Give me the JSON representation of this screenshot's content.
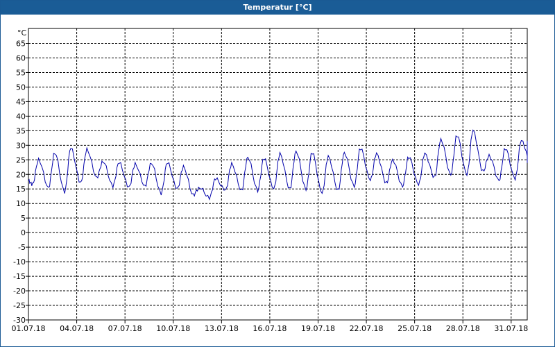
{
  "window": {
    "title": "Temperatur [°C]"
  },
  "chart_data": {
    "type": "line",
    "title": "Temperatur [°C]",
    "y_unit_label": "°C",
    "xlabel": "",
    "ylabel": "",
    "ylim": [
      -30,
      65
    ],
    "y_ticks": [
      65,
      60,
      55,
      50,
      45,
      40,
      35,
      30,
      25,
      20,
      15,
      10,
      5,
      0,
      -5,
      -10,
      -15,
      -20,
      -25,
      -30
    ],
    "x_range_days": [
      0,
      31
    ],
    "x_ticks": [
      {
        "day": 0,
        "label": "01.07.18"
      },
      {
        "day": 3,
        "label": "04.07.18"
      },
      {
        "day": 6,
        "label": "07.07.18"
      },
      {
        "day": 9,
        "label": "10.07.18"
      },
      {
        "day": 12,
        "label": "13.07.18"
      },
      {
        "day": 15,
        "label": "16.07.18"
      },
      {
        "day": 18,
        "label": "19.07.18"
      },
      {
        "day": 21,
        "label": "22.07.18"
      },
      {
        "day": 24,
        "label": "25.07.18"
      },
      {
        "day": 27,
        "label": "28.07.18"
      },
      {
        "day": 30,
        "label": "31.07.18"
      }
    ],
    "grid": true,
    "series": [
      {
        "color": "#0000aa",
        "daily": [
          {
            "min": 16.5,
            "max": 25.0
          },
          {
            "min": 15.5,
            "max": 27.5
          },
          {
            "min": 14.0,
            "max": 29.0
          },
          {
            "min": 17.0,
            "max": 28.5
          },
          {
            "min": 19.0,
            "max": 24.5
          },
          {
            "min": 16.0,
            "max": 24.0
          },
          {
            "min": 15.5,
            "max": 23.5
          },
          {
            "min": 16.0,
            "max": 24.0
          },
          {
            "min": 13.5,
            "max": 24.0
          },
          {
            "min": 15.0,
            "max": 22.5
          },
          {
            "min": 13.0,
            "max": 15.5
          },
          {
            "min": 12.0,
            "max": 18.5
          },
          {
            "min": 14.5,
            "max": 23.5
          },
          {
            "min": 14.5,
            "max": 26.0
          },
          {
            "min": 14.5,
            "max": 25.5
          },
          {
            "min": 15.0,
            "max": 27.0
          },
          {
            "min": 15.0,
            "max": 28.0
          },
          {
            "min": 15.0,
            "max": 27.5
          },
          {
            "min": 13.5,
            "max": 26.0
          },
          {
            "min": 14.5,
            "max": 27.5
          },
          {
            "min": 16.0,
            "max": 29.0
          },
          {
            "min": 18.0,
            "max": 27.0
          },
          {
            "min": 17.0,
            "max": 25.0
          },
          {
            "min": 16.0,
            "max": 26.0
          },
          {
            "min": 16.5,
            "max": 27.0
          },
          {
            "min": 19.0,
            "max": 32.0
          },
          {
            "min": 20.0,
            "max": 33.5
          },
          {
            "min": 20.0,
            "max": 35.0
          },
          {
            "min": 21.0,
            "max": 26.5
          },
          {
            "min": 18.0,
            "max": 29.0
          },
          {
            "min": 18.5,
            "max": 31.5
          },
          {
            "min": 24.0,
            "max": 31.0
          }
        ]
      }
    ]
  }
}
